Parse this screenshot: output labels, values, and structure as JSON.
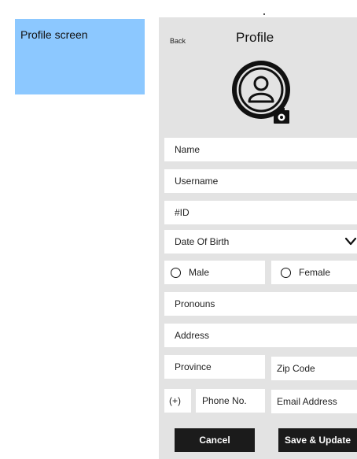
{
  "note": {
    "label": "Profile screen"
  },
  "header": {
    "back_label": "Back",
    "title": "Profile"
  },
  "form": {
    "name": "Name",
    "username": "Username",
    "id": "#ID",
    "dob": "Date Of Birth",
    "gender": {
      "male": "Male",
      "female": "Female"
    },
    "pronouns": "Pronouns",
    "address": "Address",
    "province": "Province",
    "zip": "Zip Code",
    "phone_prefix": "(+)",
    "phone": "Phone No.",
    "email": "Email Address"
  },
  "actions": {
    "cancel": "Cancel",
    "save": "Save & Update"
  },
  "icons": {
    "avatar": "user-circle-icon",
    "camera": "camera-icon",
    "dropdown": "chevron-down-icon"
  },
  "colors": {
    "note_bg": "#8cc8ff",
    "phone_bg": "#e3e3e3",
    "button_bg": "#1b1b1b"
  }
}
